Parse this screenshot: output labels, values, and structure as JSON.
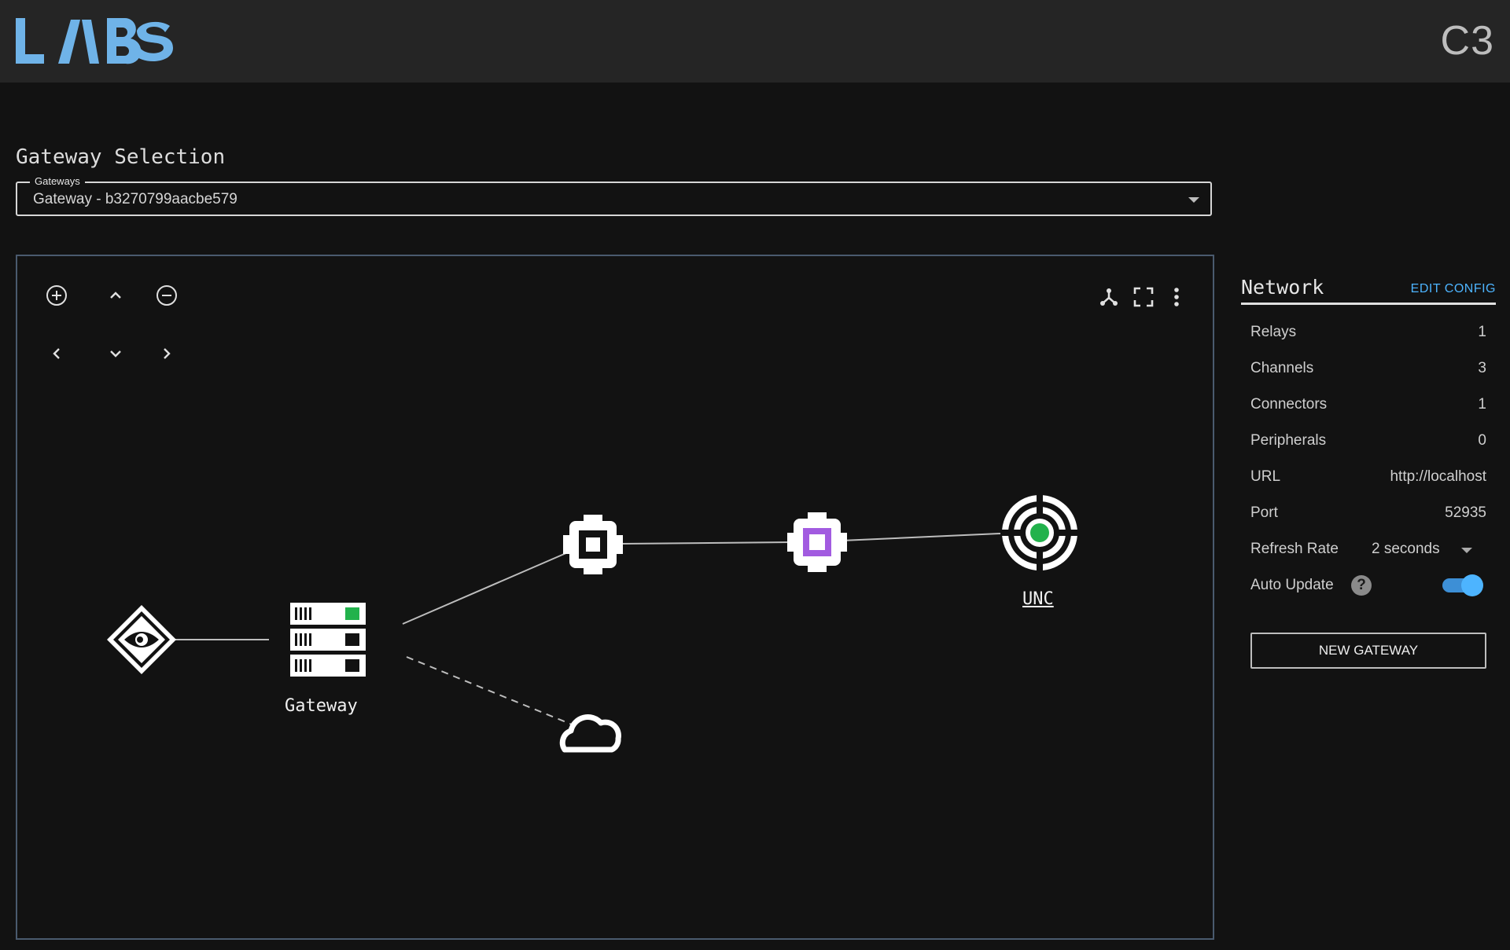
{
  "header": {
    "logo_text": "LABS",
    "app_code": "C3"
  },
  "gateway_selection": {
    "title": "Gateway Selection",
    "legend": "Gateways",
    "selected": "Gateway - b3270799aacbe579"
  },
  "graph": {
    "controls": [
      {
        "name": "zoom-in",
        "icon": "plus-circle-icon"
      },
      {
        "name": "pan-up",
        "icon": "chevron-up-icon"
      },
      {
        "name": "zoom-out",
        "icon": "minus-circle-icon"
      },
      {
        "name": "pan-left",
        "icon": "chevron-left-icon"
      },
      {
        "name": "pan-down",
        "icon": "chevron-down-icon"
      },
      {
        "name": "pan-right",
        "icon": "chevron-right-icon"
      }
    ],
    "toolbar": [
      "layout-icon",
      "fullscreen-icon",
      "more-vert-icon"
    ],
    "nodes": {
      "gateway_label": "Gateway",
      "unc_label": "UNC"
    },
    "colors": {
      "line": "#bdbdbd",
      "node": "#ffffff",
      "accent_green": "#22b24c",
      "accent_purple": "#a25be0"
    }
  },
  "network": {
    "title": "Network",
    "edit_config": "EDIT CONFIG",
    "rows": [
      {
        "label": "Relays",
        "value": "1"
      },
      {
        "label": "Channels",
        "value": "3"
      },
      {
        "label": "Connectors",
        "value": "1"
      },
      {
        "label": "Peripherals",
        "value": "0"
      },
      {
        "label": "URL",
        "value": "http://localhost"
      },
      {
        "label": "Port",
        "value": "52935"
      }
    ],
    "refresh_rate": {
      "label": "Refresh Rate",
      "value": "2 seconds"
    },
    "auto_update": {
      "label": "Auto Update",
      "help": "?",
      "enabled": true
    },
    "new_gateway": "NEW GATEWAY"
  }
}
